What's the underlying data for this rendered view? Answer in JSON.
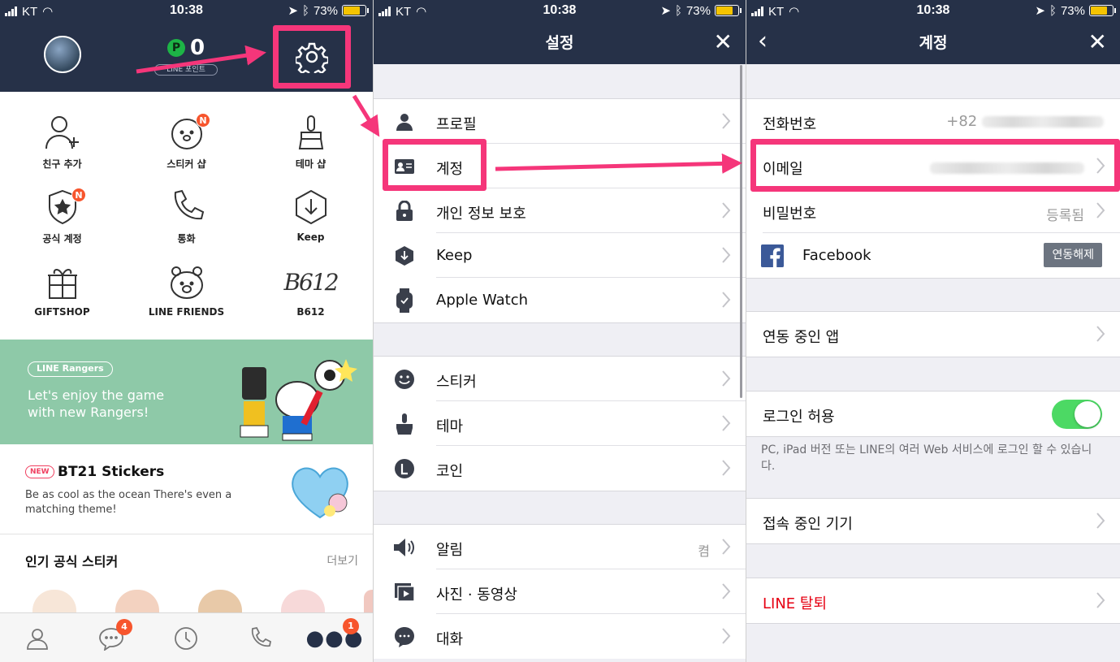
{
  "status_bar": {
    "carrier": "KT",
    "time": "10:38",
    "battery": "73%",
    "battery_level": 0.73
  },
  "panel1": {
    "points_value": "0",
    "points_icon": "P",
    "points_label": "LINE 포인트",
    "grid": [
      {
        "label": "친구 추가",
        "icon": "add-friend-icon"
      },
      {
        "label": "스티커 샵",
        "icon": "sticker-shop-icon",
        "badge": "N"
      },
      {
        "label": "테마 샵",
        "icon": "theme-shop-icon"
      },
      {
        "label": "공식 계정",
        "icon": "official-account-icon",
        "badge": "N"
      },
      {
        "label": "통화",
        "icon": "call-icon"
      },
      {
        "label": "Keep",
        "icon": "keep-icon"
      },
      {
        "label": "GIFTSHOP",
        "icon": "gift-icon"
      },
      {
        "label": "LINE FRIENDS",
        "icon": "bear-icon"
      },
      {
        "label": "B612",
        "icon": "b612-icon"
      }
    ],
    "banner": {
      "tag": "LINE Rangers",
      "line1": "Let's enjoy the game",
      "line2": "with new Rangers!"
    },
    "promo": {
      "new": "NEW",
      "title": "BT21 Stickers",
      "desc": "Be as cool as the ocean There's even a matching theme!"
    },
    "popular": {
      "title": "인기 공식 스티커",
      "more": "더보기"
    },
    "tabs": {
      "chat_badge": "4",
      "more_badge": "1"
    }
  },
  "panel2": {
    "title": "설정",
    "group1": [
      {
        "label": "프로필",
        "icon": "profile-icon"
      },
      {
        "label": "계정",
        "icon": "account-card-icon"
      },
      {
        "label": "개인 정보 보호",
        "icon": "lock-icon"
      },
      {
        "label": "Keep",
        "icon": "keep-icon"
      },
      {
        "label": "Apple Watch",
        "icon": "watch-icon"
      }
    ],
    "group2": [
      {
        "label": "스티커",
        "icon": "smile-icon"
      },
      {
        "label": "테마",
        "icon": "brush-icon"
      },
      {
        "label": "코인",
        "icon": "coin-icon"
      }
    ],
    "group3": [
      {
        "label": "알림",
        "icon": "speaker-icon",
        "value": "켬"
      },
      {
        "label": "사진 · 동영상",
        "icon": "media-icon"
      },
      {
        "label": "대화",
        "icon": "chat-icon"
      }
    ]
  },
  "panel3": {
    "title": "계정",
    "phone_label": "전화번호",
    "phone_prefix": "+82",
    "email_label": "이메일",
    "password_label": "비밀번호",
    "password_value": "등록됨",
    "facebook_label": "Facebook",
    "unlink_label": "연동해제",
    "linked_apps": "연동 중인 앱",
    "allow_login": "로그인 허용",
    "allow_login_on": true,
    "note": "PC, iPad 버전 또는 LINE의 여러 Web 서비스에 로그인 할 수 있습니다.",
    "devices": "접속 중인 기기",
    "delete_account": "LINE 탈퇴"
  },
  "colors": {
    "navy": "#263148",
    "highlight": "#f5367a",
    "toggle_on": "#4cd964",
    "badge": "#f7552d",
    "delete_red": "#e60012"
  }
}
